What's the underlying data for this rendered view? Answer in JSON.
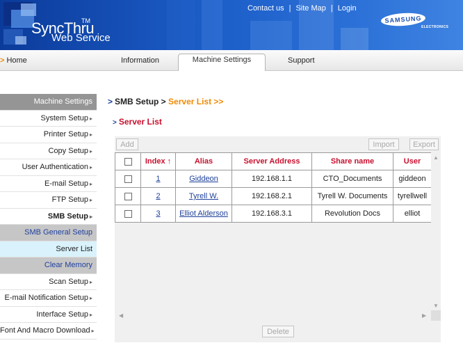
{
  "header": {
    "logo_main": "SyncThru",
    "logo_tm": "TM",
    "logo_sub": "Web Service",
    "links": [
      "Contact us",
      "Site Map",
      "Login"
    ],
    "separator": "|",
    "brand": "SAMSUNG",
    "brand_sub": "ELECTRONICS"
  },
  "nav": {
    "home": "Home",
    "tabs": [
      "Information",
      "Machine Settings",
      "Support"
    ],
    "active_tab": "Machine Settings"
  },
  "sidebar": {
    "items": [
      {
        "label": "Machine Settings",
        "style": "head"
      },
      {
        "label": "System Setup",
        "style": "chev"
      },
      {
        "label": "Printer Setup",
        "style": "chev"
      },
      {
        "label": "Copy Setup",
        "style": "chev"
      },
      {
        "label": "User Authentication",
        "style": "chev"
      },
      {
        "label": "E-mail Setup",
        "style": "chev"
      },
      {
        "label": "FTP Setup",
        "style": "chev"
      },
      {
        "label": "SMB Setup",
        "style": "bold"
      },
      {
        "label": "SMB General Setup",
        "style": "sub"
      },
      {
        "label": "Server List",
        "style": "sel"
      },
      {
        "label": "Clear Memory",
        "style": "sub"
      },
      {
        "label": "Scan Setup",
        "style": "chev"
      },
      {
        "label": "E-mail Notification Setup",
        "style": "chev"
      },
      {
        "label": "Interface Setup",
        "style": "chev"
      },
      {
        "label": "Font And Macro Download",
        "style": "chev"
      }
    ]
  },
  "breadcrumb": {
    "parent": "SMB Setup >",
    "current": "Server List >>"
  },
  "section_title": "Server List",
  "buttons": {
    "add": "Add",
    "import": "Import",
    "export": "Export",
    "delete": "Delete"
  },
  "table": {
    "columns": [
      "",
      "Index",
      "Alias",
      "Server Address",
      "Share name",
      "User"
    ],
    "sort_indicator": "↑",
    "rows": [
      {
        "index": "1",
        "alias": "Giddeon",
        "server": "192.168.1.1",
        "share": "CTO_Documents",
        "user": "giddeon"
      },
      {
        "index": "2",
        "alias": "Tyrell W.",
        "server": "192.168.2.1",
        "share": "Tyrell W. Documents",
        "user": "tyrellwell"
      },
      {
        "index": "3",
        "alias": "Elliot Alderson",
        "server": "192.168.3.1",
        "share": "Revolution Docs",
        "user": "elliot"
      }
    ]
  },
  "colors": {
    "accent": "#f08a00",
    "header_blue": "#1c5dc8",
    "heading_red": "#c8102e",
    "link_blue": "#1c3f9a"
  }
}
